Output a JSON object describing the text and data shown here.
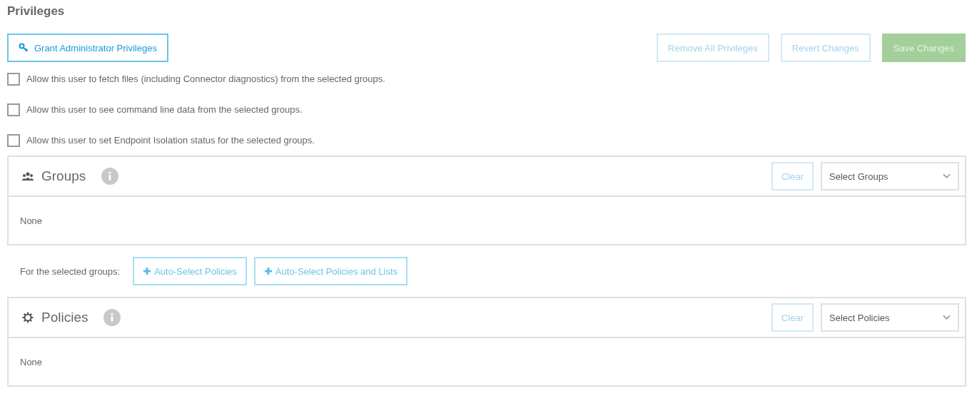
{
  "title": "Privileges",
  "grant_button": {
    "label": "Grant Administrator Privileges",
    "disabled": false
  },
  "action_buttons": [
    {
      "label": "Remove All Privileges",
      "kind": "outline",
      "disabled": true
    },
    {
      "label": "Revert Changes",
      "kind": "outline",
      "disabled": true
    },
    {
      "label": "Save Changes",
      "kind": "primary",
      "disabled": true
    }
  ],
  "options": [
    {
      "label": "Allow this user to fetch files (including Connector diagnostics) from the selected groups.",
      "checked": false
    },
    {
      "label": "Allow this user to see command line data from the selected groups.",
      "checked": false
    },
    {
      "label": "Allow this user to set Endpoint Isolation status for the selected groups.",
      "checked": false
    }
  ],
  "groups_panel": {
    "title": "Groups",
    "kind": "groups",
    "clear_button": "Clear",
    "select": {
      "placeholder": "Select Groups"
    },
    "content": "None"
  },
  "auto_select": {
    "label": "For the selected groups:",
    "buttons": [
      "Auto-Select Policies",
      "Auto-Select Policies and Lists"
    ]
  },
  "policies_panel": {
    "title": "Policies",
    "kind": "policies",
    "clear_button": "Clear",
    "select": {
      "placeholder": "Select Policies"
    },
    "content": "None"
  }
}
